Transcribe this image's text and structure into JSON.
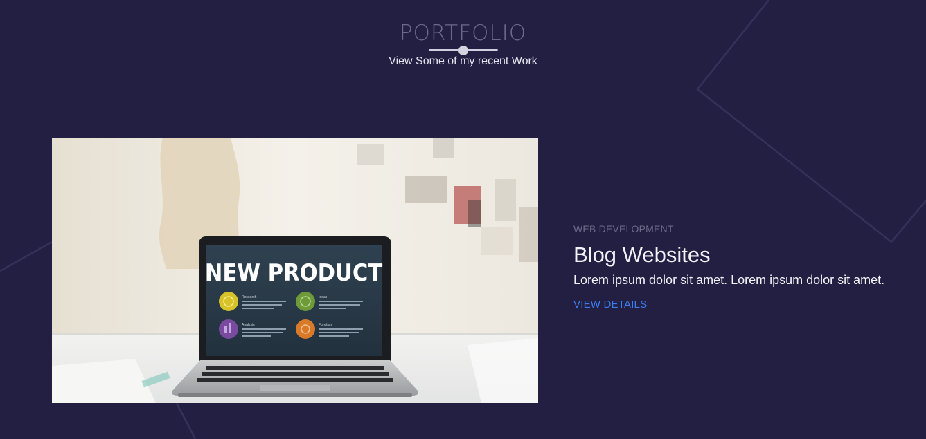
{
  "section": {
    "title": "PORTFOLIO",
    "subtitle": "View Some of my recent Work"
  },
  "project": {
    "category": "WEB DEVELOPMENT",
    "title": "Blog Websites",
    "description": "Lorem ipsum dolor sit amet. Lorem ipsum dolor sit amet.",
    "link_label": "VIEW DETAILS",
    "image": {
      "screen_heading": "NEW PRODUCT",
      "items": [
        {
          "label": "Research",
          "color": "#d8c22a"
        },
        {
          "label": "Ideas",
          "color": "#6e9a3a"
        },
        {
          "label": "Analysis",
          "color": "#7a4aa0"
        },
        {
          "label": "Function",
          "color": "#d87a2a"
        }
      ]
    }
  },
  "colors": {
    "background": "#221f42",
    "accent": "#3b7ef0",
    "muted": "#6c6a8a",
    "text": "#f2f2f8"
  }
}
